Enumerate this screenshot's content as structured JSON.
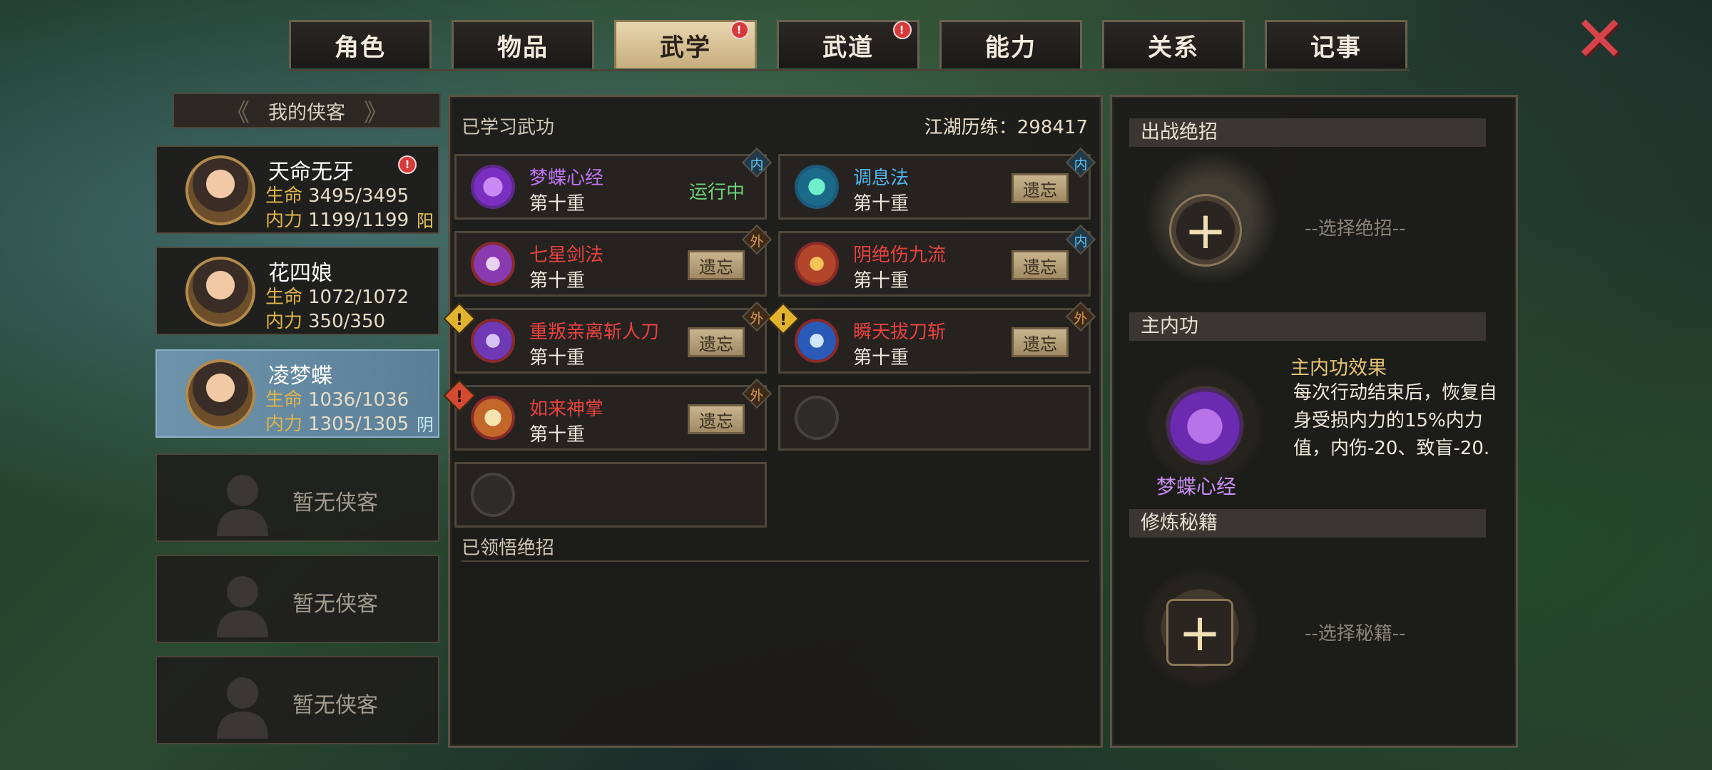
{
  "tabs": [
    {
      "label": "角色",
      "active": false,
      "badge": false
    },
    {
      "label": "物品",
      "active": false,
      "badge": false
    },
    {
      "label": "武学",
      "active": true,
      "badge": true
    },
    {
      "label": "武道",
      "active": false,
      "badge": true
    },
    {
      "label": "能力",
      "active": false,
      "badge": false
    },
    {
      "label": "关系",
      "active": false,
      "badge": false
    },
    {
      "label": "记事",
      "active": false,
      "badge": false
    }
  ],
  "badge_glyph": "!",
  "close_glyph": "✕",
  "roster": {
    "header": "我的侠客",
    "heroes": [
      {
        "name": "天命无牙",
        "hp_label": "生命",
        "hp": "3495/3495",
        "mp_label": "内力",
        "mp": "1199/1199",
        "tag": "阳",
        "alert": true,
        "selected": false
      },
      {
        "name": "花四娘",
        "hp_label": "生命",
        "hp": "1072/1072",
        "mp_label": "内力",
        "mp": "350/350",
        "tag": "",
        "alert": false,
        "selected": false
      },
      {
        "name": "凌梦蝶",
        "hp_label": "生命",
        "hp": "1036/1036",
        "mp_label": "内力",
        "mp": "1305/1305",
        "tag": "阴",
        "alert": false,
        "selected": true
      }
    ],
    "empty_slots": [
      "暂无侠客",
      "暂无侠客",
      "暂无侠客"
    ]
  },
  "learned": {
    "title": "已学习武功",
    "exp_label": "江湖历练：",
    "exp_value": "298417",
    "forget_label": "遗忘",
    "running_label": "运行中",
    "skills": [
      {
        "name": "梦蝶心经",
        "level": "第十重",
        "type": "内",
        "color": "#c174f0",
        "icon": "butterfly-icon",
        "running": true,
        "warn": ""
      },
      {
        "name": "调息法",
        "level": "第十重",
        "type": "内",
        "color": "#52b7ee",
        "icon": "heart-icon",
        "running": false,
        "warn": ""
      },
      {
        "name": "七星剑法",
        "level": "第十重",
        "type": "外",
        "color": "#e8423f",
        "icon": "sword-icon",
        "running": false,
        "warn": ""
      },
      {
        "name": "阴绝伤九流",
        "level": "第十重",
        "type": "内",
        "color": "#e8423f",
        "icon": "flame-icon",
        "running": false,
        "warn": ""
      },
      {
        "name": "重叛亲离斩人刀",
        "level": "第十重",
        "type": "外",
        "color": "#e8423f",
        "icon": "vortex-icon",
        "running": false,
        "warn": "yellow"
      },
      {
        "name": "瞬天拔刀斩",
        "level": "第十重",
        "type": "外",
        "color": "#e8423f",
        "icon": "wave-icon",
        "running": false,
        "warn": "yellow"
      },
      {
        "name": "如来神掌",
        "level": "第十重",
        "type": "外",
        "color": "#e8423f",
        "icon": "palm-icon",
        "running": false,
        "warn": "red"
      }
    ],
    "warn_glyph": "!",
    "empty_slots": 2,
    "comprehended_title": "已领悟绝招"
  },
  "right": {
    "battle_title": "出战绝招",
    "battle_placeholder": "--选择绝招--",
    "main_title": "主内功",
    "main_name": "梦蝶心经",
    "effect_title": "主内功效果",
    "effect_text": "每次行动结束后，恢复自身受损内力的15%内力值，内伤-20、致盲-20.",
    "manual_title": "修炼秘籍",
    "manual_placeholder": "--选择秘籍--",
    "plus_glyph": "+"
  }
}
